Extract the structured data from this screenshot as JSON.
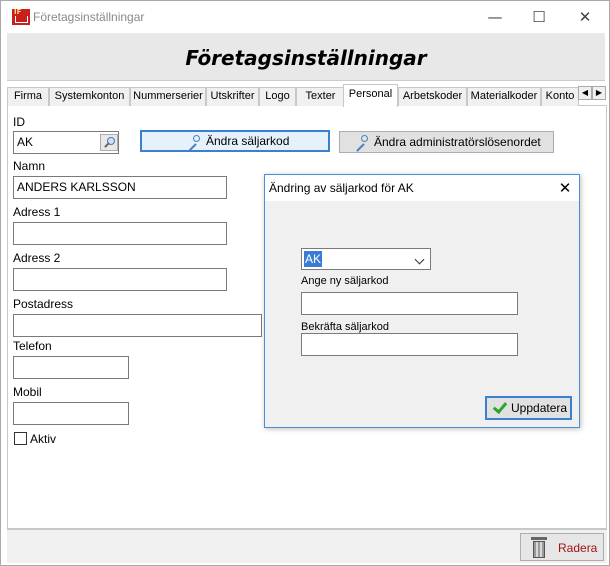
{
  "window": {
    "title": "Företagsinställningar",
    "app_icon_text": "IF",
    "minimize_glyph": "—",
    "maximize_glyph": "☐",
    "close_glyph": "✕"
  },
  "banner": {
    "title": "Företagsinställningar"
  },
  "tabs": [
    {
      "label": "Firma"
    },
    {
      "label": "Systemkonton"
    },
    {
      "label": "Nummerserier"
    },
    {
      "label": "Utskrifter"
    },
    {
      "label": "Logo"
    },
    {
      "label": "Texter"
    },
    {
      "label": "Personal",
      "active": true
    },
    {
      "label": "Arbetskoder"
    },
    {
      "label": "Materialkoder"
    },
    {
      "label": "Konto"
    }
  ],
  "tab_scroll": {
    "left": "◀",
    "right": "▶"
  },
  "form": {
    "id_label": "ID",
    "id_value": "AK",
    "change_sales_code_button": "Ändra säljarkod",
    "change_admin_password_button": "Ändra administratörslösenordet",
    "name_label": "Namn",
    "name_value": "ANDERS KARLSSON",
    "address1_label": "Adress 1",
    "address1_value": "",
    "address2_label": "Adress 2",
    "address2_value": "",
    "postal_label": "Postadress",
    "postal_value": "",
    "phone_label": "Telefon",
    "phone_value": "",
    "mobile_label": "Mobil",
    "mobile_value": "",
    "active_label": "Aktiv",
    "active_checked": false
  },
  "footer": {
    "delete_button": "Radera"
  },
  "dialog": {
    "title": "Ändring av säljarkod för AK",
    "close_glyph": "✕",
    "selected_user": "AK",
    "new_code_label": "Ange ny säljarkod",
    "new_code_value": "",
    "confirm_code_label": "Bekräfta säljarkod",
    "confirm_code_value": "",
    "update_button": "Uppdatera"
  },
  "colors": {
    "accent_blue": "#3b7fd1",
    "delete_text": "#a01414",
    "app_icon": "#c8201e"
  },
  "icons": [
    "app-icon",
    "magnifier-icon",
    "key-icon",
    "trash-icon",
    "checkmark-icon",
    "chevron-down-icon"
  ]
}
